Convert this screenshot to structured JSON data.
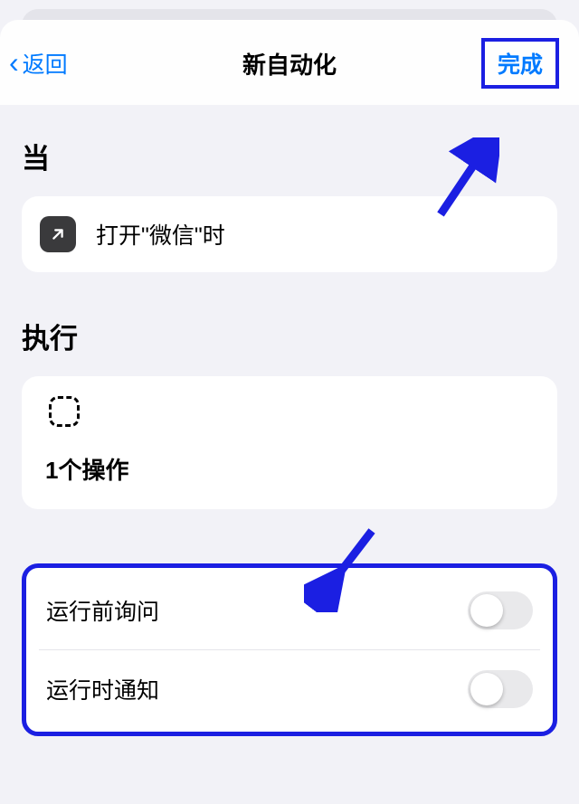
{
  "nav": {
    "back_label": "返回",
    "title": "新自动化",
    "done_label": "完成"
  },
  "sections": {
    "when_label": "当",
    "exec_label": "执行"
  },
  "trigger": {
    "text": "打开\"微信\"时"
  },
  "actions": {
    "count_text": "1个操作"
  },
  "settings": {
    "ask_before_run": "运行前询问",
    "notify_on_run": "运行时通知"
  }
}
